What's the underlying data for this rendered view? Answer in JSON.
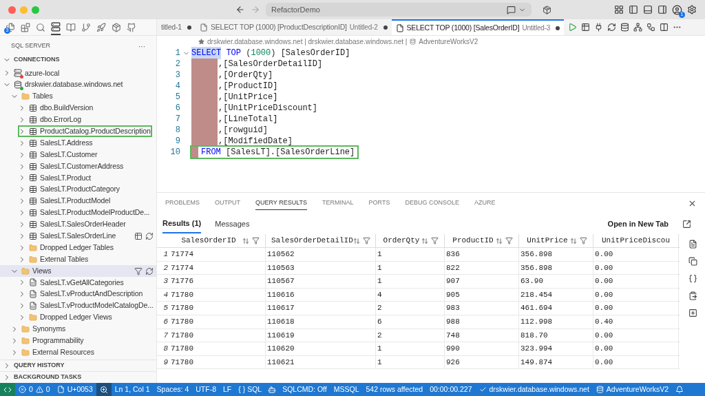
{
  "titlebar": {
    "search": "RefactorDemo",
    "account_badge": "1"
  },
  "activity": {
    "badge": "3",
    "items": [
      {
        "kind": "files",
        "selected": false
      },
      {
        "kind": "extensions",
        "selected": false
      },
      {
        "kind": "search",
        "selected": false
      },
      {
        "kind": "sql",
        "selected": true
      },
      {
        "kind": "book",
        "selected": false
      },
      {
        "kind": "branch",
        "selected": false
      },
      {
        "kind": "deploy",
        "selected": false
      },
      {
        "kind": "package",
        "selected": false
      },
      {
        "kind": "github",
        "selected": false
      }
    ]
  },
  "sidebar": {
    "title": "SQL SERVER",
    "more": "···",
    "section": "CONNECTIONS",
    "tree": [
      {
        "label": "azure-local",
        "kind": "server",
        "color": "#e0443a",
        "expanded": false,
        "selected": false
      },
      {
        "label": "drskwier.database.windows.net",
        "kind": "database",
        "color": "#2fa84f",
        "expanded": true,
        "selected": false,
        "children": [
          {
            "label": "Tables",
            "kind": "folder",
            "expanded": true,
            "selected": false,
            "children": [
              {
                "label": "dbo.BuildVersion",
                "kind": "table",
                "expanded": false,
                "selected": false
              },
              {
                "label": "dbo.ErrorLog",
                "kind": "table",
                "expanded": false,
                "selected": false
              },
              {
                "label": "ProductCatalog.ProductDescription",
                "kind": "table",
                "expanded": false,
                "selected": false,
                "outlined": true
              },
              {
                "label": "SalesLT.Address",
                "kind": "table",
                "expanded": false,
                "selected": false
              },
              {
                "label": "SalesLT.Customer",
                "kind": "table",
                "expanded": false,
                "selected": false
              },
              {
                "label": "SalesLT.CustomerAddress",
                "kind": "table",
                "expanded": false,
                "selected": false
              },
              {
                "label": "SalesLT.Product",
                "kind": "table",
                "expanded": false,
                "selected": false
              },
              {
                "label": "SalesLT.ProductCategory",
                "kind": "table",
                "expanded": false,
                "selected": false
              },
              {
                "label": "SalesLT.ProductModel",
                "kind": "table",
                "expanded": false,
                "selected": false
              },
              {
                "label": "SalesLT.ProductModelProductDe...",
                "kind": "table",
                "expanded": false,
                "selected": false
              },
              {
                "label": "SalesLT.SalesOrderHeader",
                "kind": "table",
                "expanded": false,
                "selected": false
              },
              {
                "label": "SalesLT.SalesOrderLine",
                "kind": "table",
                "expanded": false,
                "selected": false,
                "hover_actions": true
              },
              {
                "label": "Dropped Ledger Tables",
                "kind": "folder",
                "expanded": false,
                "selected": false
              },
              {
                "label": "External Tables",
                "kind": "folder",
                "expanded": false,
                "selected": false
              }
            ]
          },
          {
            "label": "Views",
            "kind": "folder",
            "expanded": true,
            "selected": true,
            "hover_actions": true,
            "children": [
              {
                "label": "SalesLT.vGetAllCategories",
                "kind": "view",
                "expanded": false,
                "selected": false
              },
              {
                "label": "SalesLT.vProductAndDescription",
                "kind": "view",
                "expanded": false,
                "selected": false
              },
              {
                "label": "SalesLT.vProductModelCatalogDe...",
                "kind": "view",
                "expanded": false,
                "selected": false
              },
              {
                "label": "Dropped Ledger Views",
                "kind": "folder",
                "expanded": false,
                "selected": false
              }
            ]
          },
          {
            "label": "Synonyms",
            "kind": "folder",
            "expanded": false,
            "selected": false
          },
          {
            "label": "Programmability",
            "kind": "folder",
            "expanded": false,
            "selected": false
          },
          {
            "label": "External Resources",
            "kind": "folder",
            "expanded": false,
            "selected": false
          }
        ]
      }
    ],
    "collapsed_sections": [
      "QUERY HISTORY",
      "BACKGROUND TASKS"
    ]
  },
  "tabs": [
    {
      "title": "titled-1",
      "dirty": true,
      "selected": false
    },
    {
      "title": "SELECT TOP (1000) [ProductDescriptionID]",
      "subtitle": "Untitled-2",
      "dirty": true,
      "selected": false
    },
    {
      "title": "SELECT TOP (1000) [SalesOrderID]",
      "subtitle": "Untitled-3",
      "dirty": true,
      "selected": true
    }
  ],
  "breadcrumb": {
    "path": "drskwier.database.windows.net | drskwier.database.windows.net |",
    "database": "AdventureWorksV2"
  },
  "code": [
    {
      "number": "1",
      "kind": "select",
      "outlined": false,
      "tokens": [
        {
          "text": "SELECT",
          "kind": "keyword",
          "selected": true
        },
        {
          "text": " TOP ",
          "kind": "keyword",
          "selected": false
        },
        {
          "text": "(",
          "kind": "punct",
          "selected": false
        },
        {
          "text": "1000",
          "kind": "number",
          "selected": false
        },
        {
          "text": ") ",
          "kind": "punct",
          "selected": false
        },
        {
          "text": "[SalesOrderID]",
          "kind": "ident",
          "selected": false
        }
      ]
    },
    {
      "number": "2",
      "kind": "column",
      "outlined": false,
      "tokens": [
        {
          "text": ",[SalesOrderDetailID]",
          "kind": "ident",
          "selected": false
        }
      ]
    },
    {
      "number": "3",
      "kind": "column",
      "outlined": false,
      "tokens": [
        {
          "text": ",[OrderQty]",
          "kind": "ident",
          "selected": false
        }
      ]
    },
    {
      "number": "4",
      "kind": "column",
      "outlined": false,
      "tokens": [
        {
          "text": ",[ProductID]",
          "kind": "ident",
          "selected": false
        }
      ]
    },
    {
      "number": "5",
      "kind": "column",
      "outlined": false,
      "tokens": [
        {
          "text": ",[UnitPrice]",
          "kind": "ident",
          "selected": false
        }
      ]
    },
    {
      "number": "6",
      "kind": "column",
      "outlined": false,
      "tokens": [
        {
          "text": ",[UnitPriceDiscount]",
          "kind": "ident",
          "selected": false
        }
      ]
    },
    {
      "number": "7",
      "kind": "column",
      "outlined": false,
      "tokens": [
        {
          "text": ",[LineTotal]",
          "kind": "ident",
          "selected": false
        }
      ]
    },
    {
      "number": "8",
      "kind": "column",
      "outlined": false,
      "tokens": [
        {
          "text": ",[rowguid]",
          "kind": "ident",
          "selected": false
        }
      ]
    },
    {
      "number": "9",
      "kind": "column",
      "outlined": false,
      "tokens": [
        {
          "text": ",[ModifiedDate]",
          "kind": "ident",
          "selected": false
        }
      ]
    },
    {
      "number": "10",
      "kind": "from",
      "outlined": true,
      "tokens": [
        {
          "text": "FROM ",
          "kind": "keyword",
          "selected": false
        },
        {
          "text": "[SalesLT].[SalesOrderLine]",
          "kind": "ident",
          "selected": false
        }
      ]
    }
  ],
  "panel": {
    "tabs": [
      {
        "label": "PROBLEMS",
        "selected": false
      },
      {
        "label": "OUTPUT",
        "selected": false
      },
      {
        "label": "QUERY RESULTS",
        "selected": true
      },
      {
        "label": "TERMINAL",
        "selected": false
      },
      {
        "label": "PORTS",
        "selected": false
      },
      {
        "label": "DEBUG CONSOLE",
        "selected": false
      },
      {
        "label": "AZURE",
        "selected": false
      }
    ],
    "result_tabs": [
      {
        "label": "Results (1)",
        "selected": true
      },
      {
        "label": "Messages",
        "selected": false
      }
    ],
    "open_new_tab": "Open in New Tab",
    "table": {
      "columns": [
        {
          "label": "SalesOrderID",
          "tools": true
        },
        {
          "label": "SalesOrderDetailID",
          "tools": true
        },
        {
          "label": "OrderQty",
          "tools": true
        },
        {
          "label": "ProductID",
          "tools": true
        },
        {
          "label": "UnitPrice",
          "tools": true
        },
        {
          "label": "UnitPriceDiscou",
          "tools": false
        }
      ],
      "rows": [
        {
          "number": "1",
          "cells": [
            "71774",
            "110562",
            "1",
            "836",
            "356.898",
            "0.00"
          ]
        },
        {
          "number": "2",
          "cells": [
            "71774",
            "110563",
            "1",
            "822",
            "356.898",
            "0.00"
          ]
        },
        {
          "number": "3",
          "cells": [
            "71776",
            "110567",
            "1",
            "907",
            "63.90",
            "0.00"
          ]
        },
        {
          "number": "4",
          "cells": [
            "71780",
            "110616",
            "4",
            "905",
            "218.454",
            "0.00"
          ]
        },
        {
          "number": "5",
          "cells": [
            "71780",
            "110617",
            "2",
            "983",
            "461.694",
            "0.00"
          ]
        },
        {
          "number": "6",
          "cells": [
            "71780",
            "110618",
            "6",
            "988",
            "112.998",
            "0.40"
          ]
        },
        {
          "number": "7",
          "cells": [
            "71780",
            "110619",
            "2",
            "748",
            "818.70",
            "0.00"
          ]
        },
        {
          "number": "8",
          "cells": [
            "71780",
            "110620",
            "1",
            "990",
            "323.994",
            "0.00"
          ]
        },
        {
          "number": "9",
          "cells": [
            "71780",
            "110621",
            "1",
            "926",
            "149.874",
            "0.00"
          ]
        }
      ]
    }
  },
  "status_bar": [
    {
      "kind": "remote"
    },
    {
      "kind": "problems",
      "errors": "0",
      "warnings": "0"
    },
    {
      "kind": "character",
      "text": "U+0053"
    },
    {
      "kind": "zoom"
    },
    {
      "kind": "text",
      "text": "Ln 1, Col 1"
    },
    {
      "kind": "text",
      "text": "Spaces: 4"
    },
    {
      "kind": "text",
      "text": "UTF-8"
    },
    {
      "kind": "text",
      "text": "LF"
    },
    {
      "kind": "text",
      "text": "{ } SQL"
    },
    {
      "kind": "copilot"
    },
    {
      "kind": "text",
      "text": "SQLCMD: Off"
    },
    {
      "kind": "text",
      "text": "MSSQL"
    },
    {
      "kind": "text",
      "text": "542 rows affected"
    },
    {
      "kind": "text",
      "text": "00:00:00.227"
    },
    {
      "kind": "connection",
      "text": "drskwier.database.windows.net"
    },
    {
      "kind": "database",
      "text": "AdventureWorksV2"
    },
    {
      "kind": "bell"
    }
  ]
}
